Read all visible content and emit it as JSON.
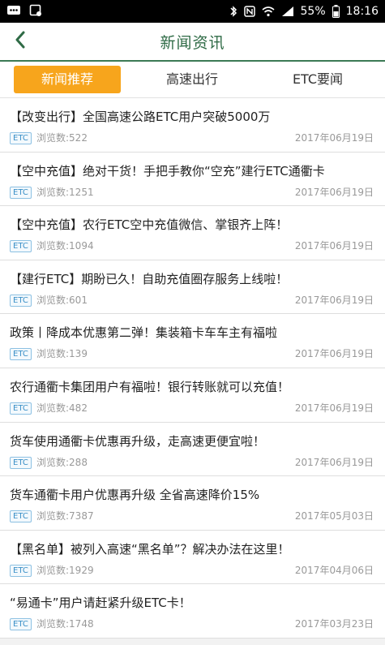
{
  "statusbar": {
    "battery": "55%",
    "time": "18:16"
  },
  "header": {
    "title": "新闻资讯"
  },
  "tabs": [
    {
      "label": "新闻推荐",
      "active": true
    },
    {
      "label": "高速出行",
      "active": false
    },
    {
      "label": "ETC要闻",
      "active": false
    }
  ],
  "news": [
    {
      "title": "【改变出行】全国高速公路ETC用户突破5000万",
      "badge": "ETC",
      "views": "浏览数:522",
      "date": "2017年06月19日"
    },
    {
      "title": "【空中充值】绝对干货！手把手教你“空充”建行ETC通衢卡",
      "badge": "ETC",
      "views": "浏览数:1251",
      "date": "2017年06月19日"
    },
    {
      "title": "【空中充值】农行ETC空中充值微信、掌银齐上阵！",
      "badge": "ETC",
      "views": "浏览数:1094",
      "date": "2017年06月19日"
    },
    {
      "title": "【建行ETC】期盼已久！自助充值圈存服务上线啦！",
      "badge": "ETC",
      "views": "浏览数:601",
      "date": "2017年06月19日"
    },
    {
      "title": "政策丨降成本优惠第二弹！集装箱卡车车主有福啦",
      "badge": "ETC",
      "views": "浏览数:139",
      "date": "2017年06月19日"
    },
    {
      "title": "农行通衢卡集团用户有福啦！银行转账就可以充值！",
      "badge": "ETC",
      "views": "浏览数:482",
      "date": "2017年06月19日"
    },
    {
      "title": "货车使用通衢卡优惠再升级，走高速更便宜啦！",
      "badge": "ETC",
      "views": "浏览数:288",
      "date": "2017年06月19日"
    },
    {
      "title": "货车通衢卡用户优惠再升级 全省高速降价15%",
      "badge": "ETC",
      "views": "浏览数:7387",
      "date": "2017年05月03日"
    },
    {
      "title": "【黑名单】被列入高速“黑名单”？解决办法在这里！",
      "badge": "ETC",
      "views": "浏览数:1929",
      "date": "2017年04月06日"
    },
    {
      "title": "“易通卡”用户请赶紧升级ETC卡！",
      "badge": "ETC",
      "views": "浏览数:1748",
      "date": "2017年03月23日"
    }
  ],
  "colors": {
    "accent": "#f7a51c",
    "title_green": "#2f6b46",
    "badge_blue": "#3a8fc7"
  }
}
